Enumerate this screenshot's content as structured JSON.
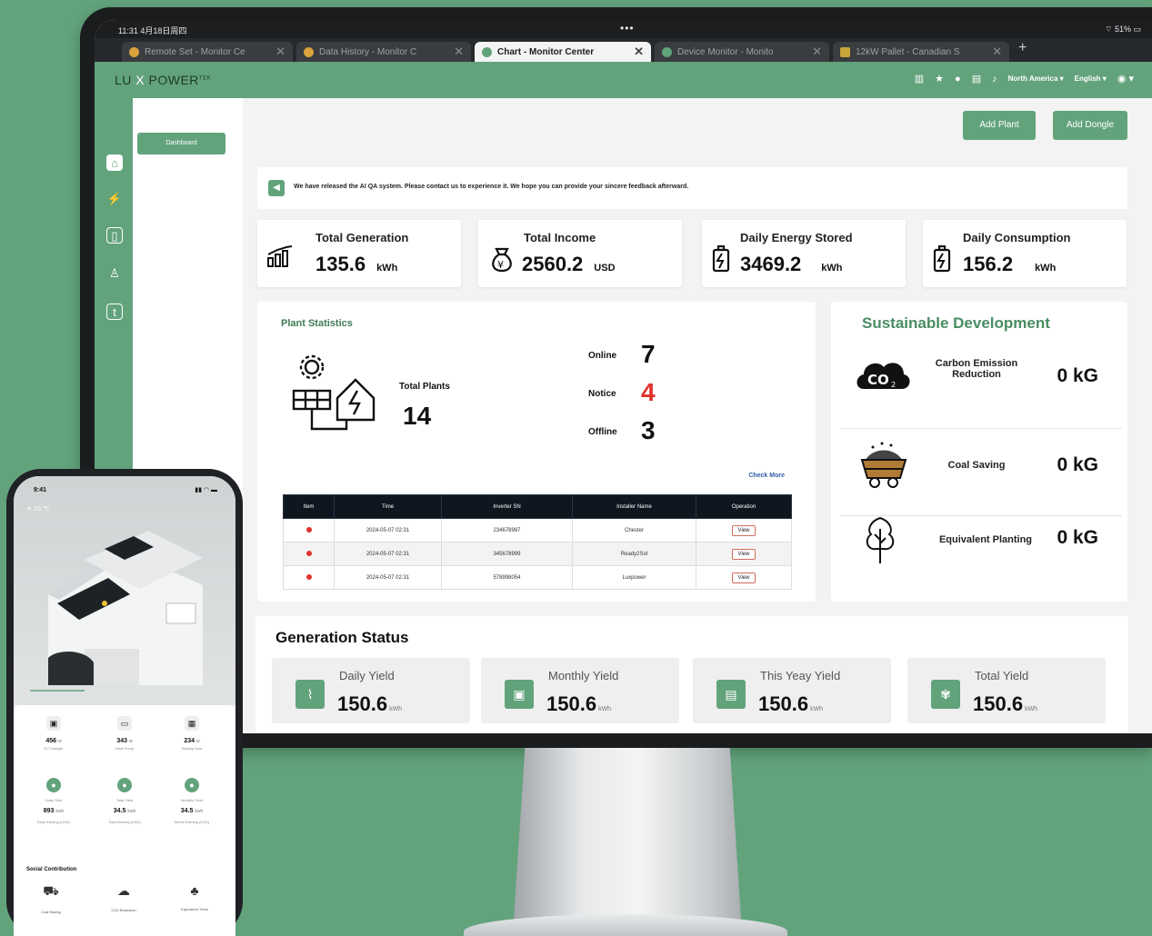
{
  "browser": {
    "status_time": "11:31  4月18日周四",
    "status_right": "51%",
    "tabs": [
      {
        "label": "Remote Set - Monitor Ce",
        "active": false
      },
      {
        "label": "Data History - Monitor C",
        "active": false
      },
      {
        "label": "Chart - Monitor Center",
        "active": true
      },
      {
        "label": "Device Monitor - Monito",
        "active": false
      },
      {
        "label": "12kW Pallet - Canadian S",
        "active": false
      }
    ],
    "new_tab": "+"
  },
  "header": {
    "logo_lu": "LU",
    "logo_x": "X",
    "logo_power": "POWER",
    "logo_tek": "TEK",
    "region": "North America",
    "language": "English"
  },
  "sidebar": {
    "items": [
      "home",
      "bolt",
      "device",
      "users",
      "tariff"
    ],
    "nav_button": "Dashboard"
  },
  "toolbar": {
    "add_plant": "Add Plant",
    "add_dongle": "Add Dongle"
  },
  "notice": "We have released the AI QA system. Please contact us to experience it. We hope you can provide your sincere feedback afterward.",
  "kpis": [
    {
      "title": "Total Generation",
      "value": "135.6",
      "unit": "kWh",
      "icon": "bar-chart-icon"
    },
    {
      "title": "Total Income",
      "value": "2560.2",
      "unit": "USD",
      "icon": "money-bag-icon"
    },
    {
      "title": "Daily Energy Stored",
      "value": "3469.2",
      "unit": "kWh",
      "icon": "battery-icon"
    },
    {
      "title": "Daily Consumption",
      "value": "156.2",
      "unit": "kWh",
      "icon": "battery-icon"
    }
  ],
  "plant_statistics": {
    "title": "Plant Statistics",
    "total_label": "Total Plants",
    "total_value": "14",
    "online_label": "Online",
    "online_value": "7",
    "notice_label": "Notice",
    "notice_value": "4",
    "offline_label": "Offline",
    "offline_value": "3",
    "check_more": "Check More",
    "table": {
      "headers": [
        "Item",
        "Time",
        "Inverter SN",
        "Installer Name",
        "Operation"
      ],
      "rows": [
        {
          "time": "2024-05-07 02:31",
          "sn": "234678987",
          "installer": "Chester",
          "op": "View"
        },
        {
          "time": "2024-05-07 02:31",
          "sn": "345678999",
          "installer": "Ready2Sol",
          "op": "View"
        },
        {
          "time": "2024-05-07 02:31",
          "sn": "578998054",
          "installer": "Luxpower",
          "op": "View"
        }
      ]
    }
  },
  "sustainable": {
    "title": "Sustainable Development",
    "items": [
      {
        "label": "Carbon Emission Reduction",
        "value": "0 kG",
        "icon": "co2-cloud-icon"
      },
      {
        "label": "Coal Saving",
        "value": "0 kG",
        "icon": "coal-cart-icon"
      },
      {
        "label": "Equivalent Planting",
        "value": "0 kG",
        "icon": "tree-icon"
      }
    ]
  },
  "generation": {
    "title": "Generation Status",
    "items": [
      {
        "label": "Daily Yield",
        "value": "150.6",
        "unit": "kWh"
      },
      {
        "label": "Monthly Yield",
        "value": "150.6",
        "unit": "kWh"
      },
      {
        "label": "This Yeay Yield",
        "value": "150.6",
        "unit": "kWh"
      },
      {
        "label": "Total Yield",
        "value": "150.6",
        "unit": "kWh"
      }
    ]
  },
  "phone": {
    "time": "9:41",
    "temp": "25 ℃",
    "devices": [
      {
        "value": "456",
        "unit": "w",
        "label": "EV Charger"
      },
      {
        "value": "343",
        "unit": "w",
        "label": "Heat Pump"
      },
      {
        "value": "234",
        "unit": "w",
        "label": "Backup load"
      }
    ],
    "yields": [
      {
        "title": "Daily Yield",
        "value": "893",
        "unit": "kwh",
        "sub": "Daily Earning (USD)"
      },
      {
        "title": "Total Yield",
        "value": "34.5",
        "unit": "kwh",
        "sub": "Total Earning (USD)"
      },
      {
        "title": "Monthly Yield",
        "value": "34.5",
        "unit": "kwh",
        "sub": "Month Earning (USD)"
      }
    ],
    "social_title": "Social Contribution",
    "social": [
      "Coal Saving",
      "CO2 Reduction",
      "Equivalent Trees"
    ]
  },
  "colors": {
    "accent": "#62a37c",
    "notice_red": "#e0322c"
  }
}
